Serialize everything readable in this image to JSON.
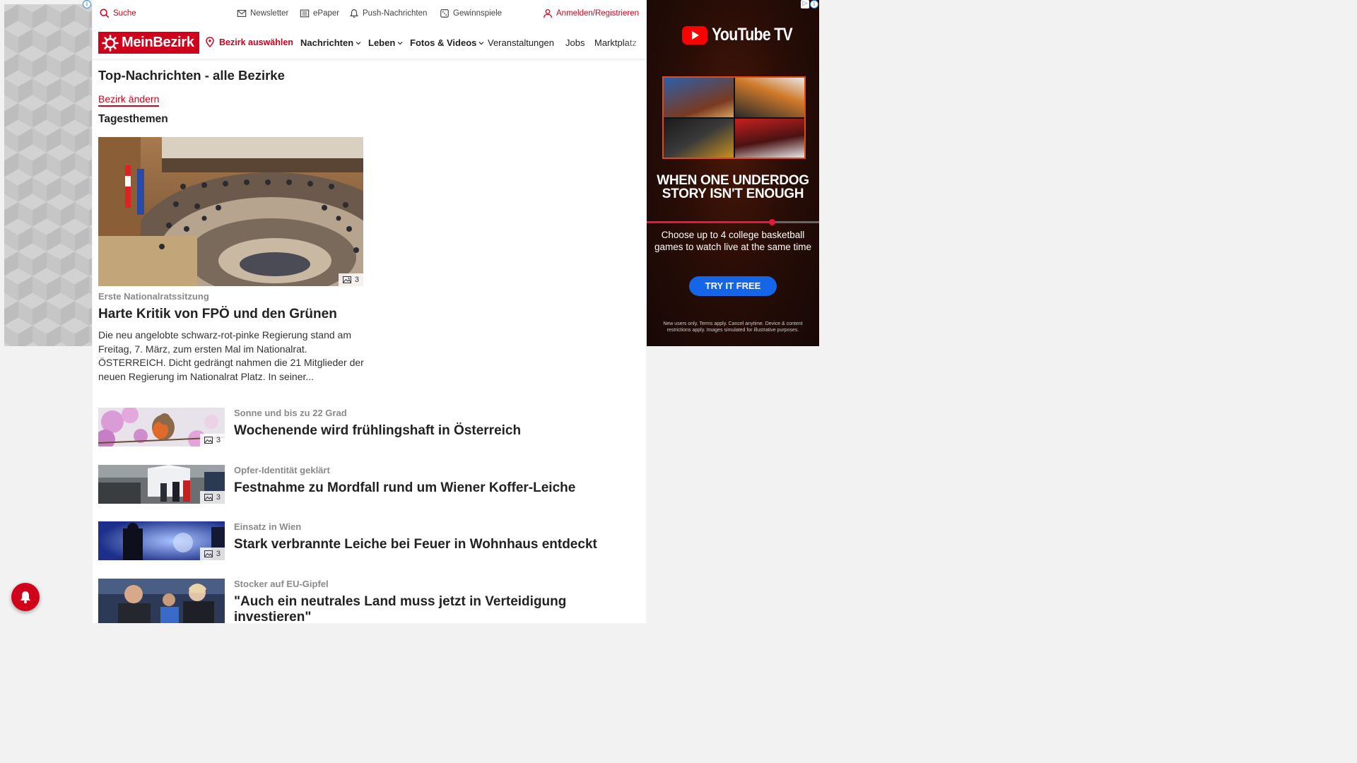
{
  "topbar": {
    "search": "Suche",
    "newsletter": "Newsletter",
    "epaper": "ePaper",
    "push": "Push-Nachrichten",
    "gewinnspiele": "Gewinnspiele",
    "login": "Anmelden/Registrieren"
  },
  "nav": {
    "logo": "MeinBezirk",
    "select_district": "Bezirk auswählen",
    "items": [
      "Nachrichten",
      "Leben",
      "Fotos & Videos",
      "Veranstaltungen",
      "Jobs",
      "Marktplatz"
    ]
  },
  "page": {
    "title": "Top-Nachrichten - alle Bezirke",
    "change_district": "Bezirk ändern",
    "section": "Tagesthemen"
  },
  "hero": {
    "image_count": "3",
    "kicker": "Erste Nationalratssitzung",
    "headline": "Harte Kritik von FPÖ und den Grünen",
    "teaser": "Die neu angelobte schwarz-rot-pinke Regierung stand am Freitag, 7. März, zum ersten Mal im Nationalrat. ÖSTERREICH. Dicht gedrängt nahmen die 21 Mitglieder der neuen Regierung im Nationalrat Platz. In seiner..."
  },
  "articles": [
    {
      "kicker": "Sonne und bis zu 22 Grad",
      "headline": "Wochenende wird frühlingshaft in Österreich",
      "image_count": "3"
    },
    {
      "kicker": "Opfer-Identität geklärt",
      "headline": "Festnahme zu Mordfall rund um Wiener Koffer-Leiche",
      "image_count": "3"
    },
    {
      "kicker": "Einsatz in Wien",
      "headline": "Stark verbrannte Leiche bei Feuer in Wohnhaus entdeckt",
      "image_count": "3"
    },
    {
      "kicker": "Stocker auf EU-Gipfel",
      "headline": "\"Auch ein neutrales Land muss jetzt in Verteidigung investieren\""
    }
  ],
  "ad": {
    "brand": "YouTube TV",
    "headline": "WHEN ONE UNDERDOG STORY ISN'T ENOUGH",
    "body": "Choose up to 4 college basketball games to watch live at the same time",
    "cta": "TRY IT FREE",
    "fine_print": "New users only. Terms apply. Cancel anytime. Device & content restrictions apply. Images simulated for illustrative purposes."
  },
  "colors": {
    "brand_red": "#d0021b",
    "cta_blue": "#1565e8"
  }
}
